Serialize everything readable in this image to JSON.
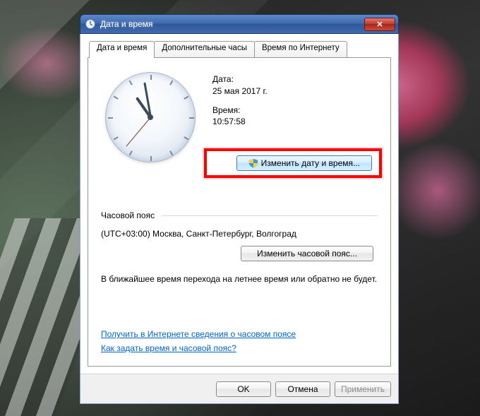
{
  "window": {
    "title": "Дата и время"
  },
  "tabs": [
    {
      "label": "Дата и время",
      "active": true
    },
    {
      "label": "Дополнительные часы",
      "active": false
    },
    {
      "label": "Время по Интернету",
      "active": false
    }
  ],
  "datetime": {
    "date_label": "Дата:",
    "date_value": "25 мая 2017 г.",
    "time_label": "Время:",
    "time_value": "10:57:58",
    "change_button": "Изменить дату и время..."
  },
  "timezone": {
    "section_label": "Часовой пояс",
    "value": "(UTC+03:00) Москва, Санкт-Петербург, Волгоград",
    "change_button": "Изменить часовой пояс..."
  },
  "dst_notice": "В ближайшее время перехода на летнее время или обратно не будет.",
  "links": {
    "learn_tz": "Получить в Интернете сведения о часовом поясе",
    "howto": "Как задать время и часовой пояс?"
  },
  "footer": {
    "ok": "OK",
    "cancel": "Отмена",
    "apply": "Применить"
  }
}
